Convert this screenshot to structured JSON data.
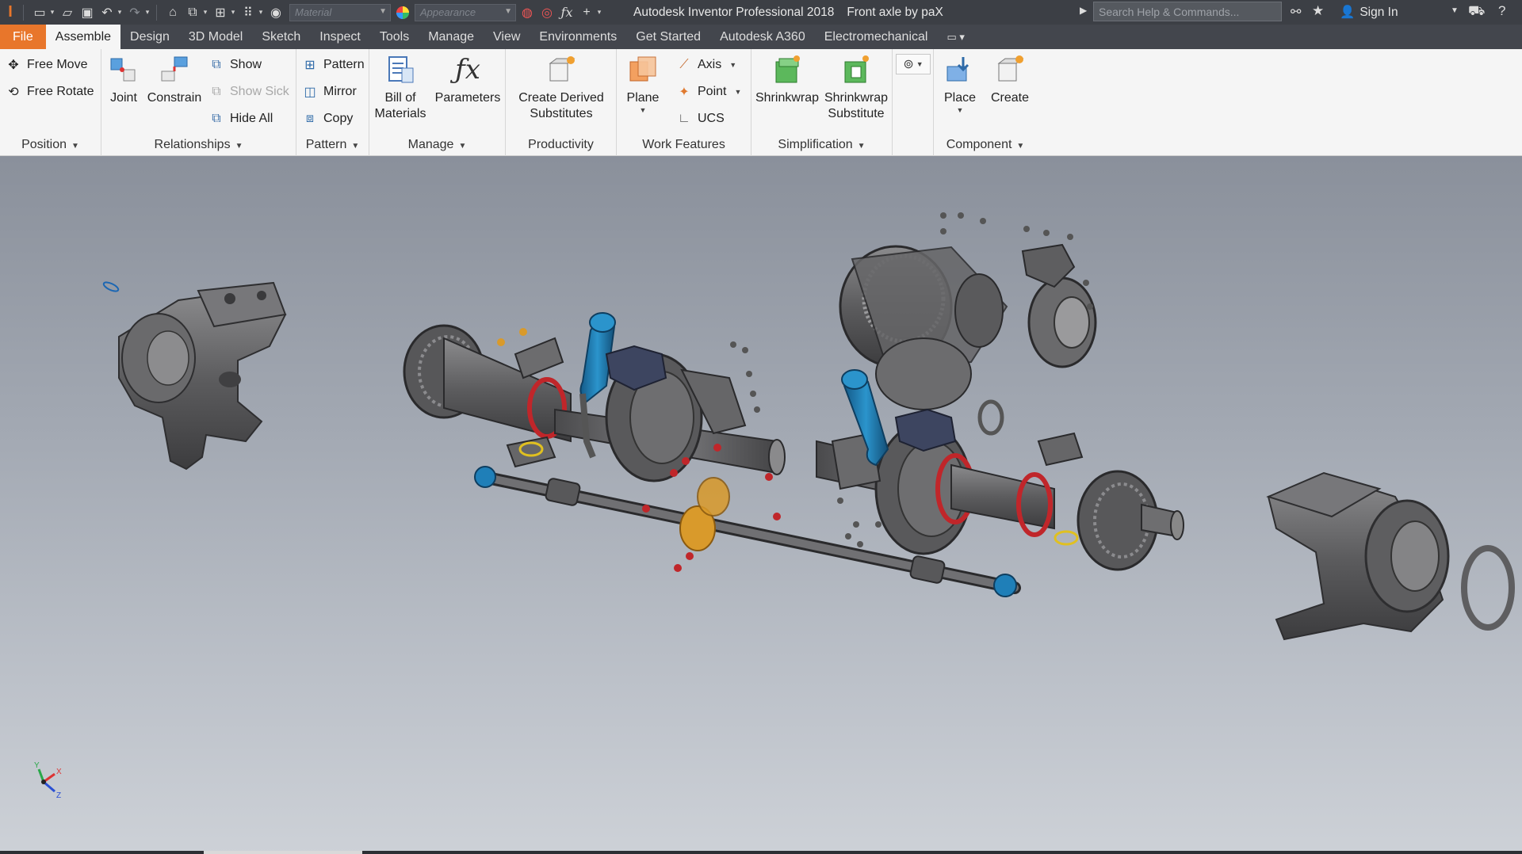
{
  "titlebar": {
    "material_placeholder": "Material",
    "appearance_placeholder": "Appearance",
    "app_title": "Autodesk Inventor Professional 2018",
    "doc_title": "Front axle by paX",
    "search_placeholder": "Search Help & Commands...",
    "sign_in": "Sign In"
  },
  "tabs": [
    {
      "label": "File"
    },
    {
      "label": "Assemble"
    },
    {
      "label": "Design"
    },
    {
      "label": "3D Model"
    },
    {
      "label": "Sketch"
    },
    {
      "label": "Inspect"
    },
    {
      "label": "Tools"
    },
    {
      "label": "Manage"
    },
    {
      "label": "View"
    },
    {
      "label": "Environments"
    },
    {
      "label": "Get Started"
    },
    {
      "label": "Autodesk A360"
    },
    {
      "label": "Electromechanical"
    }
  ],
  "ribbon": {
    "position": {
      "label": "Position",
      "free_move": "Free Move",
      "free_rotate": "Free Rotate"
    },
    "relationships": {
      "label": "Relationships",
      "joint": "Joint",
      "constrain": "Constrain",
      "show": "Show",
      "show_sick": "Show Sick",
      "hide_all": "Hide All"
    },
    "pattern": {
      "label": "Pattern",
      "pattern": "Pattern",
      "mirror": "Mirror",
      "copy": "Copy"
    },
    "manage": {
      "label": "Manage",
      "bom_line1": "Bill of",
      "bom_line2": "Materials",
      "parameters": "Parameters"
    },
    "productivity": {
      "label": "Productivity",
      "line1": "Create Derived",
      "line2": "Substitutes"
    },
    "work_features": {
      "label": "Work Features",
      "plane": "Plane",
      "axis": "Axis",
      "point": "Point",
      "ucs": "UCS"
    },
    "simplification": {
      "label": "Simplification",
      "shrinkwrap": "Shrinkwrap",
      "sw_sub_line1": "Shrinkwrap",
      "sw_sub_line2": "Substitute"
    },
    "component": {
      "label": "Component",
      "place": "Place",
      "create": "Create"
    }
  },
  "viewcube": {
    "x": "X",
    "y": "Y",
    "z": "Z"
  },
  "colors": {
    "file_tab": "#e8762b",
    "viewport_top": "#8a909b",
    "viewport_bottom": "#cdd1d7",
    "part_gray": "#5e5e60",
    "accent_blue": "#1f7fb8",
    "accent_red": "#c0262a",
    "accent_yellow": "#e0c020",
    "accent_orange": "#d99a2b"
  }
}
